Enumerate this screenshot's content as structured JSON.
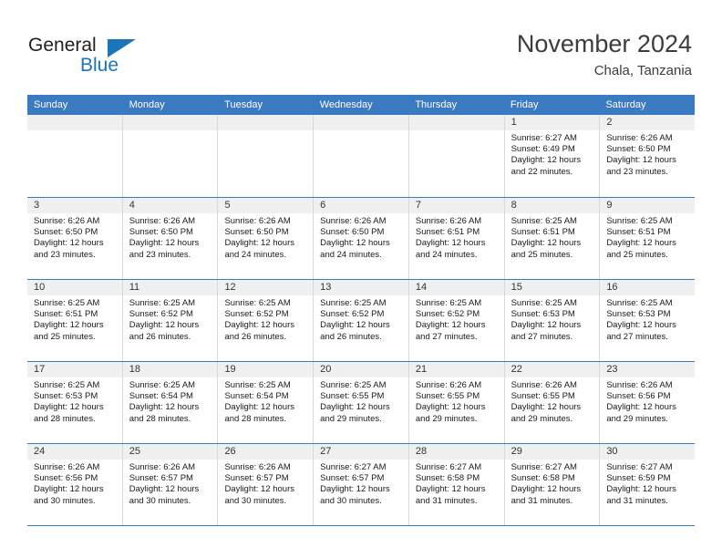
{
  "brand": {
    "name_part1": "General",
    "name_part2": "Blue",
    "flag_icon": "blue-triangle-flag-icon"
  },
  "header": {
    "title": "November 2024",
    "subtitle": "Chala, Tanzania"
  },
  "colors": {
    "header_blue": "#3a7ac0",
    "brand_blue": "#1b75bb",
    "day_strip_gray": "#f0f0f0",
    "cell_border": "#d8d8d8",
    "title_text": "#3c3c3b"
  },
  "calendar": {
    "weekdays": [
      "Sunday",
      "Monday",
      "Tuesday",
      "Wednesday",
      "Thursday",
      "Friday",
      "Saturday"
    ],
    "weeks": [
      [
        {
          "day": "",
          "empty": true,
          "sunrise": "",
          "sunset": "",
          "daylight_line1": "",
          "daylight_line2": ""
        },
        {
          "day": "",
          "empty": true,
          "sunrise": "",
          "sunset": "",
          "daylight_line1": "",
          "daylight_line2": ""
        },
        {
          "day": "",
          "empty": true,
          "sunrise": "",
          "sunset": "",
          "daylight_line1": "",
          "daylight_line2": ""
        },
        {
          "day": "",
          "empty": true,
          "sunrise": "",
          "sunset": "",
          "daylight_line1": "",
          "daylight_line2": ""
        },
        {
          "day": "",
          "empty": true,
          "sunrise": "",
          "sunset": "",
          "daylight_line1": "",
          "daylight_line2": ""
        },
        {
          "day": "1",
          "empty": false,
          "sunrise": "Sunrise: 6:27 AM",
          "sunset": "Sunset: 6:49 PM",
          "daylight_line1": "Daylight: 12 hours",
          "daylight_line2": "and 22 minutes."
        },
        {
          "day": "2",
          "empty": false,
          "sunrise": "Sunrise: 6:26 AM",
          "sunset": "Sunset: 6:50 PM",
          "daylight_line1": "Daylight: 12 hours",
          "daylight_line2": "and 23 minutes."
        }
      ],
      [
        {
          "day": "3",
          "empty": false,
          "sunrise": "Sunrise: 6:26 AM",
          "sunset": "Sunset: 6:50 PM",
          "daylight_line1": "Daylight: 12 hours",
          "daylight_line2": "and 23 minutes."
        },
        {
          "day": "4",
          "empty": false,
          "sunrise": "Sunrise: 6:26 AM",
          "sunset": "Sunset: 6:50 PM",
          "daylight_line1": "Daylight: 12 hours",
          "daylight_line2": "and 23 minutes."
        },
        {
          "day": "5",
          "empty": false,
          "sunrise": "Sunrise: 6:26 AM",
          "sunset": "Sunset: 6:50 PM",
          "daylight_line1": "Daylight: 12 hours",
          "daylight_line2": "and 24 minutes."
        },
        {
          "day": "6",
          "empty": false,
          "sunrise": "Sunrise: 6:26 AM",
          "sunset": "Sunset: 6:50 PM",
          "daylight_line1": "Daylight: 12 hours",
          "daylight_line2": "and 24 minutes."
        },
        {
          "day": "7",
          "empty": false,
          "sunrise": "Sunrise: 6:26 AM",
          "sunset": "Sunset: 6:51 PM",
          "daylight_line1": "Daylight: 12 hours",
          "daylight_line2": "and 24 minutes."
        },
        {
          "day": "8",
          "empty": false,
          "sunrise": "Sunrise: 6:25 AM",
          "sunset": "Sunset: 6:51 PM",
          "daylight_line1": "Daylight: 12 hours",
          "daylight_line2": "and 25 minutes."
        },
        {
          "day": "9",
          "empty": false,
          "sunrise": "Sunrise: 6:25 AM",
          "sunset": "Sunset: 6:51 PM",
          "daylight_line1": "Daylight: 12 hours",
          "daylight_line2": "and 25 minutes."
        }
      ],
      [
        {
          "day": "10",
          "empty": false,
          "sunrise": "Sunrise: 6:25 AM",
          "sunset": "Sunset: 6:51 PM",
          "daylight_line1": "Daylight: 12 hours",
          "daylight_line2": "and 25 minutes."
        },
        {
          "day": "11",
          "empty": false,
          "sunrise": "Sunrise: 6:25 AM",
          "sunset": "Sunset: 6:52 PM",
          "daylight_line1": "Daylight: 12 hours",
          "daylight_line2": "and 26 minutes."
        },
        {
          "day": "12",
          "empty": false,
          "sunrise": "Sunrise: 6:25 AM",
          "sunset": "Sunset: 6:52 PM",
          "daylight_line1": "Daylight: 12 hours",
          "daylight_line2": "and 26 minutes."
        },
        {
          "day": "13",
          "empty": false,
          "sunrise": "Sunrise: 6:25 AM",
          "sunset": "Sunset: 6:52 PM",
          "daylight_line1": "Daylight: 12 hours",
          "daylight_line2": "and 26 minutes."
        },
        {
          "day": "14",
          "empty": false,
          "sunrise": "Sunrise: 6:25 AM",
          "sunset": "Sunset: 6:52 PM",
          "daylight_line1": "Daylight: 12 hours",
          "daylight_line2": "and 27 minutes."
        },
        {
          "day": "15",
          "empty": false,
          "sunrise": "Sunrise: 6:25 AM",
          "sunset": "Sunset: 6:53 PM",
          "daylight_line1": "Daylight: 12 hours",
          "daylight_line2": "and 27 minutes."
        },
        {
          "day": "16",
          "empty": false,
          "sunrise": "Sunrise: 6:25 AM",
          "sunset": "Sunset: 6:53 PM",
          "daylight_line1": "Daylight: 12 hours",
          "daylight_line2": "and 27 minutes."
        }
      ],
      [
        {
          "day": "17",
          "empty": false,
          "sunrise": "Sunrise: 6:25 AM",
          "sunset": "Sunset: 6:53 PM",
          "daylight_line1": "Daylight: 12 hours",
          "daylight_line2": "and 28 minutes."
        },
        {
          "day": "18",
          "empty": false,
          "sunrise": "Sunrise: 6:25 AM",
          "sunset": "Sunset: 6:54 PM",
          "daylight_line1": "Daylight: 12 hours",
          "daylight_line2": "and 28 minutes."
        },
        {
          "day": "19",
          "empty": false,
          "sunrise": "Sunrise: 6:25 AM",
          "sunset": "Sunset: 6:54 PM",
          "daylight_line1": "Daylight: 12 hours",
          "daylight_line2": "and 28 minutes."
        },
        {
          "day": "20",
          "empty": false,
          "sunrise": "Sunrise: 6:25 AM",
          "sunset": "Sunset: 6:55 PM",
          "daylight_line1": "Daylight: 12 hours",
          "daylight_line2": "and 29 minutes."
        },
        {
          "day": "21",
          "empty": false,
          "sunrise": "Sunrise: 6:26 AM",
          "sunset": "Sunset: 6:55 PM",
          "daylight_line1": "Daylight: 12 hours",
          "daylight_line2": "and 29 minutes."
        },
        {
          "day": "22",
          "empty": false,
          "sunrise": "Sunrise: 6:26 AM",
          "sunset": "Sunset: 6:55 PM",
          "daylight_line1": "Daylight: 12 hours",
          "daylight_line2": "and 29 minutes."
        },
        {
          "day": "23",
          "empty": false,
          "sunrise": "Sunrise: 6:26 AM",
          "sunset": "Sunset: 6:56 PM",
          "daylight_line1": "Daylight: 12 hours",
          "daylight_line2": "and 29 minutes."
        }
      ],
      [
        {
          "day": "24",
          "empty": false,
          "sunrise": "Sunrise: 6:26 AM",
          "sunset": "Sunset: 6:56 PM",
          "daylight_line1": "Daylight: 12 hours",
          "daylight_line2": "and 30 minutes."
        },
        {
          "day": "25",
          "empty": false,
          "sunrise": "Sunrise: 6:26 AM",
          "sunset": "Sunset: 6:57 PM",
          "daylight_line1": "Daylight: 12 hours",
          "daylight_line2": "and 30 minutes."
        },
        {
          "day": "26",
          "empty": false,
          "sunrise": "Sunrise: 6:26 AM",
          "sunset": "Sunset: 6:57 PM",
          "daylight_line1": "Daylight: 12 hours",
          "daylight_line2": "and 30 minutes."
        },
        {
          "day": "27",
          "empty": false,
          "sunrise": "Sunrise: 6:27 AM",
          "sunset": "Sunset: 6:57 PM",
          "daylight_line1": "Daylight: 12 hours",
          "daylight_line2": "and 30 minutes."
        },
        {
          "day": "28",
          "empty": false,
          "sunrise": "Sunrise: 6:27 AM",
          "sunset": "Sunset: 6:58 PM",
          "daylight_line1": "Daylight: 12 hours",
          "daylight_line2": "and 31 minutes."
        },
        {
          "day": "29",
          "empty": false,
          "sunrise": "Sunrise: 6:27 AM",
          "sunset": "Sunset: 6:58 PM",
          "daylight_line1": "Daylight: 12 hours",
          "daylight_line2": "and 31 minutes."
        },
        {
          "day": "30",
          "empty": false,
          "sunrise": "Sunrise: 6:27 AM",
          "sunset": "Sunset: 6:59 PM",
          "daylight_line1": "Daylight: 12 hours",
          "daylight_line2": "and 31 minutes."
        }
      ]
    ]
  }
}
